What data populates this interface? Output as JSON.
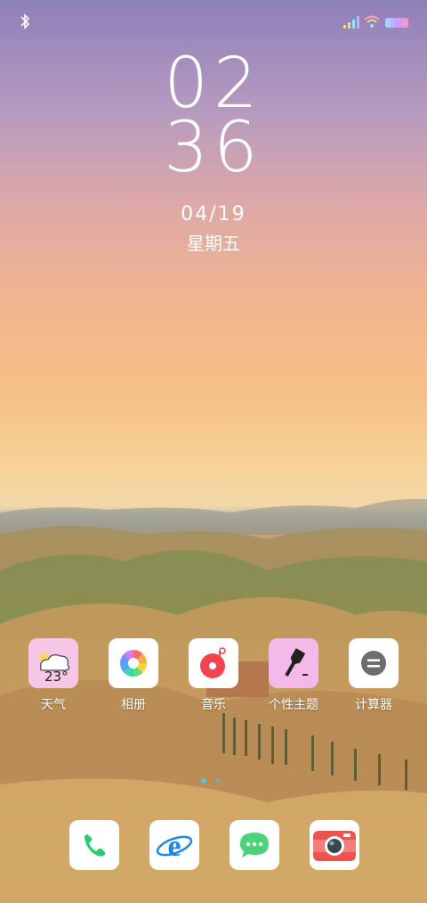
{
  "status_bar": {
    "left_icon": "bluetooth-icon",
    "right_icons": [
      "signal-icon",
      "wifi-icon",
      "battery-icon"
    ]
  },
  "lockscreen": {
    "hour": "02",
    "minute": "36",
    "date": "04/19",
    "weekday": "星期五"
  },
  "home_apps": [
    {
      "label": "天气",
      "icon": "weather-icon",
      "badge": "23°"
    },
    {
      "label": "相册",
      "icon": "gallery-icon"
    },
    {
      "label": "音乐",
      "icon": "music-icon"
    },
    {
      "label": "个性主题",
      "icon": "theme-brush-icon"
    },
    {
      "label": "计算器",
      "icon": "calculator-icon"
    }
  ],
  "page_indicator": {
    "pages": 2,
    "active": 1
  },
  "dock": [
    {
      "icon": "phone-icon"
    },
    {
      "icon": "browser-icon"
    },
    {
      "icon": "messages-icon"
    },
    {
      "icon": "camera-icon"
    }
  ],
  "colors": {
    "accent_dot": "#4fc3e8",
    "weather_tile": "#f6c6e6",
    "theme_tile": "#f3b9e8",
    "phone_green": "#2ecc71",
    "browser_blue": "#1e88e5",
    "message_green": "#4cd37a",
    "camera_red": "#ef5350",
    "music_red": "#f44352"
  }
}
